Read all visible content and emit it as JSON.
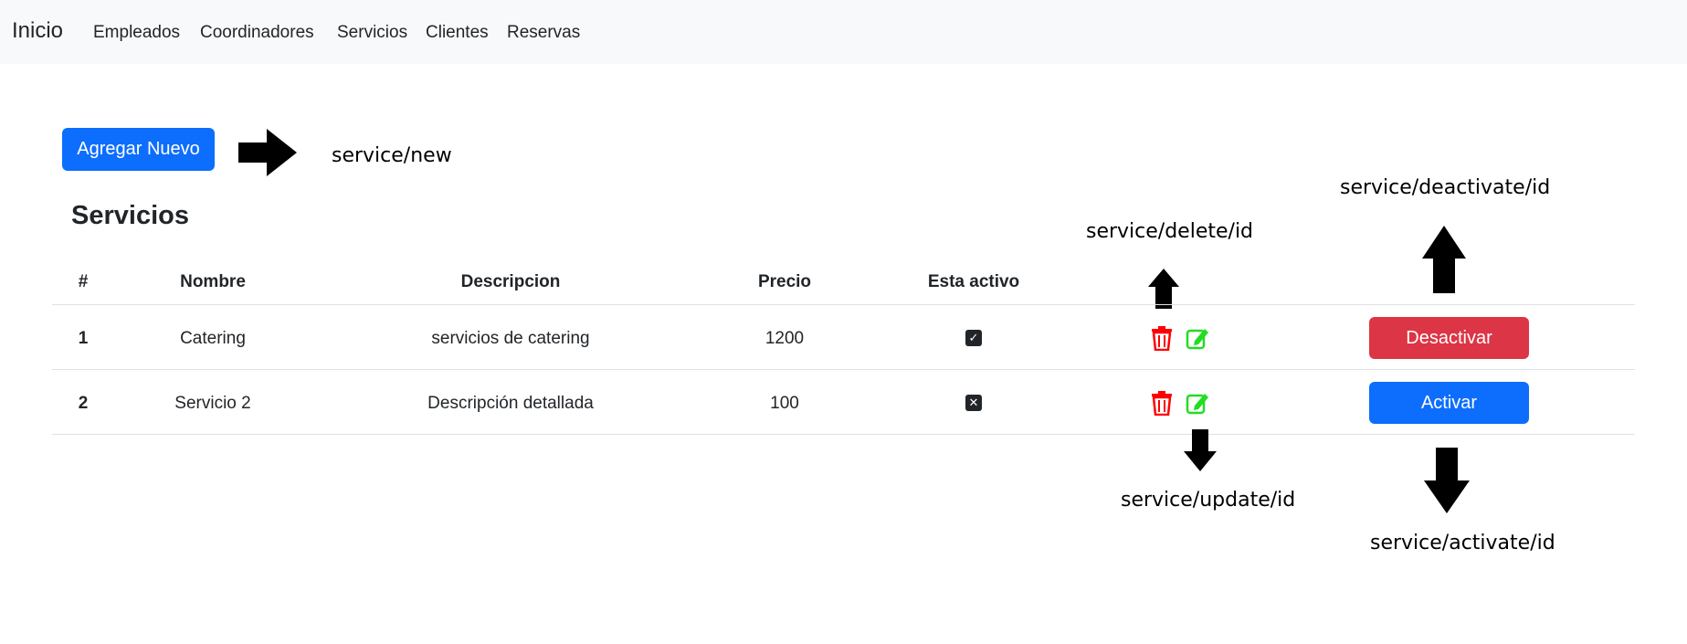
{
  "navbar": {
    "brand": "Inicio",
    "links": [
      "Empleados",
      "Coordinadores",
      "Servicios",
      "Clientes",
      "Reservas"
    ]
  },
  "actions": {
    "add_new_label": "Agregar Nuevo"
  },
  "page_title": "Servicios",
  "table": {
    "columns": [
      "#",
      "Nombre",
      "Descripcion",
      "Precio",
      "Esta activo"
    ],
    "rows": [
      {
        "id": "1",
        "name": "Catering",
        "description": "servicios de catering",
        "price": "1200",
        "active": true,
        "toggle_label": "Desactivar"
      },
      {
        "id": "2",
        "name": "Servicio 2",
        "description": "Descripción detallada",
        "price": "100",
        "active": false,
        "toggle_label": "Activar"
      }
    ]
  },
  "annotations": {
    "new": "service/new",
    "deactivate": "service/deactivate/id",
    "delete": "service/delete/id",
    "update": "service/update/id",
    "activate": "service/activate/id"
  },
  "icons": {
    "delete": "trash-icon",
    "edit": "edit-icon",
    "checked": "checkbox-checked-icon",
    "unchecked": "checkbox-x-icon",
    "arrow": "arrow-icon"
  },
  "colors": {
    "primary": "#0d6efd",
    "danger": "#dc3545",
    "delete_icon": "#ff0000",
    "edit_icon": "#22dd22",
    "navbar_bg": "#f8f9fa"
  }
}
